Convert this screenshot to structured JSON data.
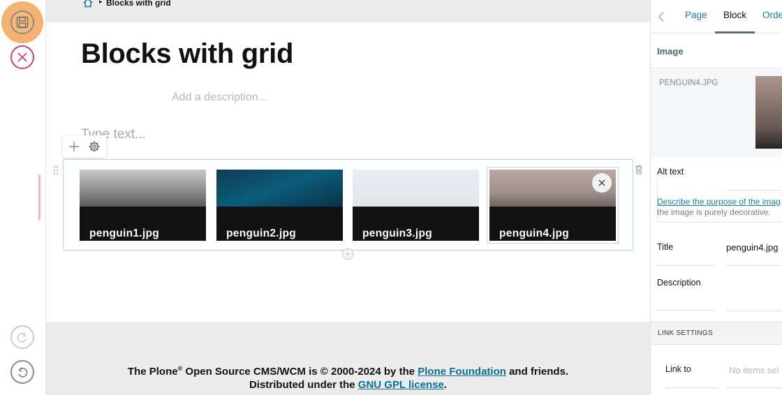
{
  "toolbar": {
    "save_label": "Save",
    "cancel_label": "Cancel",
    "redo_label": "Redo",
    "undo_label": "Undo"
  },
  "breadcrumb": {
    "current": "Blocks with grid"
  },
  "page": {
    "title": "Blocks with grid",
    "description_placeholder": "Add a description...",
    "text_placeholder": "Type text..."
  },
  "grid": {
    "items": [
      {
        "caption": "penguin1.jpg"
      },
      {
        "caption": "penguin2.jpg"
      },
      {
        "caption": "penguin3.jpg"
      },
      {
        "caption": "penguin4.jpg",
        "selected": true
      }
    ]
  },
  "footer": {
    "line1_prefix": "The Plone",
    "line1_reg": "®",
    "line1_middle": " Open Source CMS/WCM is ",
    "line1_copy": "©",
    "line1_years": " 2000-2024 by the ",
    "line1_link": "Plone Foundation",
    "line1_suffix": " and friends.",
    "line2_prefix": "Distributed under the ",
    "line2_link": "GNU GPL license",
    "line2_suffix": "."
  },
  "sidebar": {
    "tabs": [
      {
        "label": "Page"
      },
      {
        "label": "Block",
        "active": true
      },
      {
        "label": "Orde"
      }
    ],
    "section_title": "Image",
    "image_filename": "PENGUIN4.JPG",
    "alt_text_label": "Alt text",
    "alt_text_link": "Describe the purpose of the imag",
    "alt_text_help": "the image is purely decorative.",
    "title_label": "Title",
    "title_value": "penguin4.jpg",
    "description_label": "Description",
    "link_settings_title": "LINK SETTINGS",
    "link_to_label": "Link to",
    "link_to_placeholder": "No items sel"
  },
  "colors": {
    "accent": "#167fa3",
    "save_highlight": "#f2a45b",
    "cancel": "#c2407d",
    "grid_border": "#b8d8d2"
  }
}
